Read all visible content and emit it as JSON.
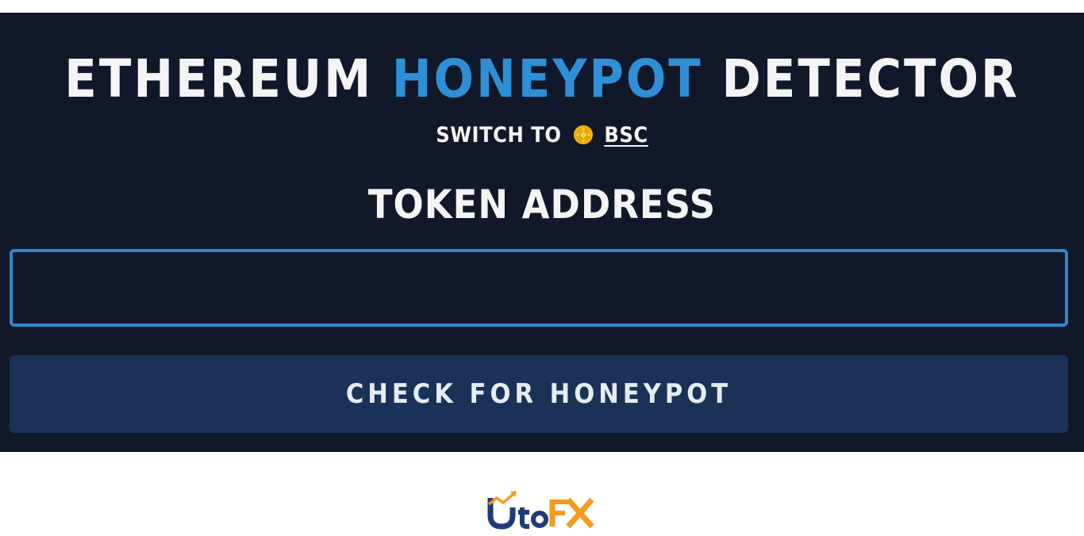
{
  "header": {
    "title_part1": "ETHEREUM ",
    "title_accent": "HONEYPOT",
    "title_part2": " DETECTOR",
    "switch_prefix": "SWITCH TO",
    "switch_link": "BSC",
    "coin_icon": "bnb-coin-icon"
  },
  "form": {
    "label": "TOKEN ADDRESS",
    "address_value": "",
    "address_placeholder": "",
    "submit_label": "CHECK FOR HONEYPOT"
  },
  "watermark": {
    "logo_text": "UtoFX"
  },
  "colors": {
    "panel_bg": "#11182a",
    "accent": "#2f8fd6",
    "button_bg": "#1b3258",
    "logo_navy": "#1f3a78",
    "logo_orange": "#f39a1f"
  }
}
